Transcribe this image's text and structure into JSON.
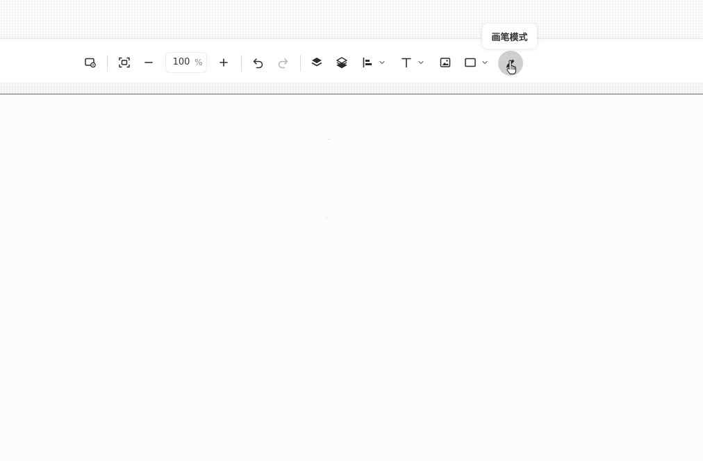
{
  "toolbar": {
    "zoom": {
      "value": "100",
      "unit": "%"
    },
    "tools": [
      {
        "name": "screen-settings",
        "icon": "monitor-gear-icon"
      },
      {
        "name": "fit-to-screen",
        "icon": "frame-focus-icon"
      },
      {
        "name": "zoom-out",
        "icon": "minus-icon"
      },
      {
        "name": "zoom-in",
        "icon": "plus-icon"
      },
      {
        "name": "undo",
        "icon": "undo-icon"
      },
      {
        "name": "redo",
        "icon": "redo-icon",
        "enabled": false
      },
      {
        "name": "bring-to-front",
        "icon": "layer-up-icon"
      },
      {
        "name": "send-to-back",
        "icon": "layers-icon"
      },
      {
        "name": "align",
        "icon": "align-left-icon",
        "has_dropdown": true
      },
      {
        "name": "text",
        "icon": "text-icon",
        "has_dropdown": true
      },
      {
        "name": "image",
        "icon": "image-icon"
      },
      {
        "name": "shape",
        "icon": "rectangle-icon",
        "has_dropdown": true
      },
      {
        "name": "pen",
        "icon": "pen-icon",
        "active": true
      }
    ]
  },
  "tooltip": {
    "text": "画笔模式"
  },
  "colors": {
    "icon": "#2b2b2b",
    "active_bg": "#cfcfcf",
    "canvas_border": "#5c5cc0"
  }
}
